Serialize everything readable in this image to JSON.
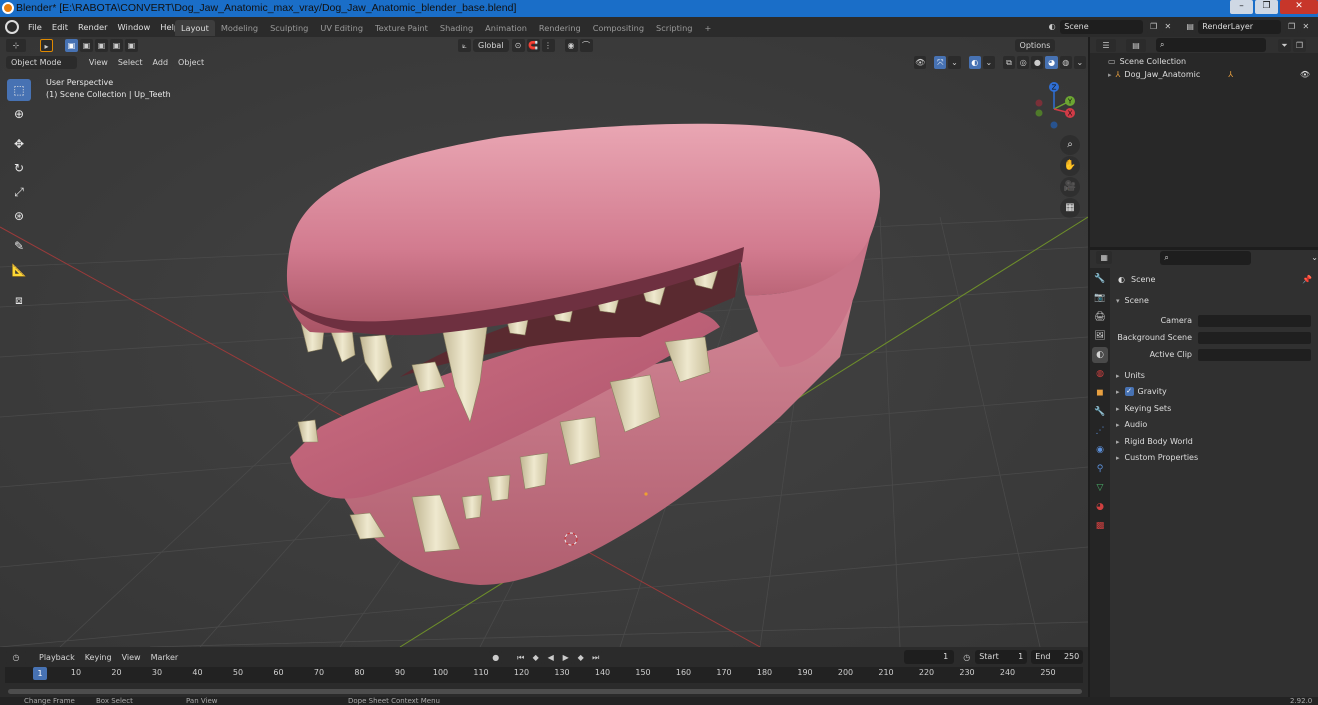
{
  "window": {
    "title": "Blender* [E:\\RABOTA\\CONVERT\\Dog_Jaw_Anatomic_max_vray/Dog_Jaw_Anatomic_blender_base.blend]"
  },
  "menu": {
    "items": [
      "File",
      "Edit",
      "Render",
      "Window",
      "Help"
    ]
  },
  "workspaces": {
    "tabs": [
      "Layout",
      "Modeling",
      "Sculpting",
      "UV Editing",
      "Texture Paint",
      "Shading",
      "Animation",
      "Rendering",
      "Compositing",
      "Scripting"
    ],
    "active": "Layout",
    "add": "+"
  },
  "scene_selector": {
    "value": "Scene"
  },
  "view_layer_selector": {
    "value": "RenderLayer"
  },
  "viewport": {
    "mode": "Object Mode",
    "menus": [
      "View",
      "Select",
      "Add",
      "Object"
    ],
    "orientation": "Global",
    "options": "Options",
    "overlay_line1": "User Perspective",
    "overlay_line2": "(1) Scene Collection | Up_Teeth",
    "gizmo_axes": [
      "Z",
      "Y",
      "X"
    ]
  },
  "outliner": {
    "root": "Scene Collection",
    "object": "Dog_Jaw_Anatomic"
  },
  "properties": {
    "context": "Scene",
    "panel": "Scene",
    "fields": [
      {
        "label": "Camera"
      },
      {
        "label": "Background Scene"
      },
      {
        "label": "Active Clip"
      }
    ],
    "sections": [
      "Units",
      "Gravity",
      "Keying Sets",
      "Audio",
      "Rigid Body World",
      "Custom Properties"
    ],
    "gravity_checked": true
  },
  "timeline": {
    "menus": [
      "Playback",
      "Keying",
      "View",
      "Marker"
    ],
    "current_frame": "1",
    "start_label": "Start",
    "start": "1",
    "end_label": "End",
    "end": "250",
    "ruler_ticks": [
      "10",
      "20",
      "30",
      "40",
      "50",
      "60",
      "70",
      "80",
      "90",
      "100",
      "110",
      "120",
      "130",
      "140",
      "150",
      "160",
      "170",
      "180",
      "190",
      "200",
      "210",
      "220",
      "230",
      "240",
      "250"
    ],
    "cursor_label": "1"
  },
  "statusbar": {
    "items": [
      "Change Frame",
      "Box Select",
      "Pan View",
      "Dope Sheet Context Menu"
    ],
    "version": "2.92.0"
  },
  "colors": {
    "accent": "#4772b3",
    "viewport_bg": "#3c3c3c",
    "title_blue": "#1a6ec8",
    "gum_pink": "#d77d90",
    "tooth": "#e6dfbe"
  }
}
